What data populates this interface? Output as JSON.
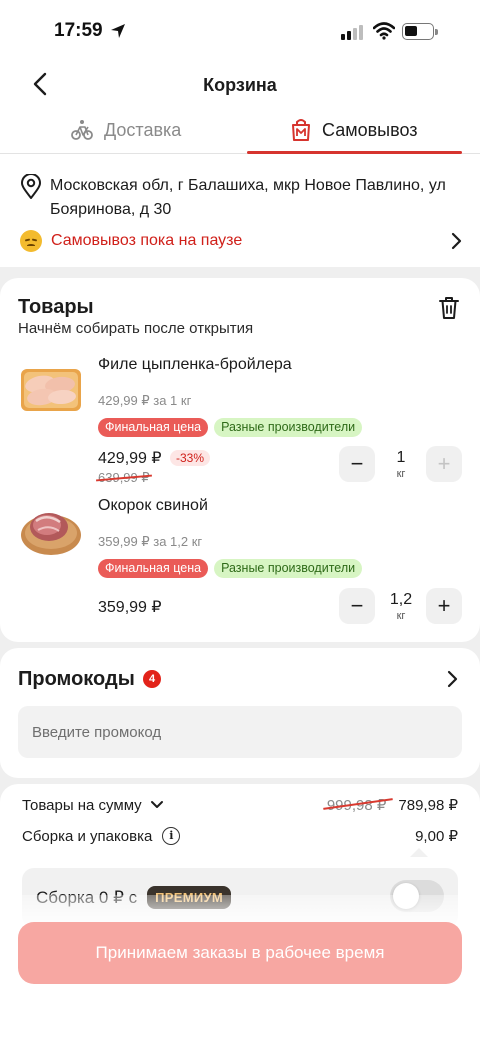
{
  "status_bar": {
    "time": "17:59"
  },
  "header": {
    "title": "Корзина"
  },
  "tabs": [
    {
      "label": "Доставка",
      "icon": "bicycle-icon",
      "active": false
    },
    {
      "label": "Самовывоз",
      "icon": "store-icon",
      "active": true
    }
  ],
  "address": {
    "text": "Московская обл, г Балашиха, мкр Новое Павлино, ул Бояринова, д 30",
    "pause_notice": "Самовывоз пока на паузе"
  },
  "products_section": {
    "title": "Товары",
    "subtitle": "Начнём собирать после открытия",
    "items": [
      {
        "name": "Филе цыпленка-бройлера",
        "unit_price": "429,99 ₽ за 1 кг",
        "badges": [
          "Финальная цена",
          "Разные производители"
        ],
        "price": "429,99 ₽",
        "discount": "-33%",
        "old_price": "639,99 ₽",
        "quantity": "1",
        "quantity_unit": "кг",
        "minus": "−",
        "plus": "+"
      },
      {
        "name": "Окорок свиной",
        "unit_price": "359,99 ₽ за 1,2 кг",
        "badges": [
          "Финальная цена",
          "Разные производители"
        ],
        "price": "359,99 ₽",
        "quantity": "1,2",
        "quantity_unit": "кг",
        "minus": "−",
        "plus": "+"
      }
    ]
  },
  "promo": {
    "title": "Промокоды",
    "count": "4",
    "placeholder": "Введите промокод"
  },
  "summary": {
    "goods_label": "Товары на сумму",
    "goods_old": "999,98 ₽",
    "goods_total": "789,98 ₽",
    "assembly_label": "Сборка и упаковка",
    "assembly_cost": "9,00 ₽",
    "info_glyph": "i",
    "assembly_free_text": "Сборка 0 ₽ с",
    "premium_label": "ПРЕМИУМ"
  },
  "cta": {
    "label": "Принимаем заказы в рабочее время"
  },
  "colors": {
    "accent": "#d6342e",
    "cta": "#f7a7a2",
    "final_badge": "#ea5b57",
    "makers_badge": "#d7f5c3"
  }
}
